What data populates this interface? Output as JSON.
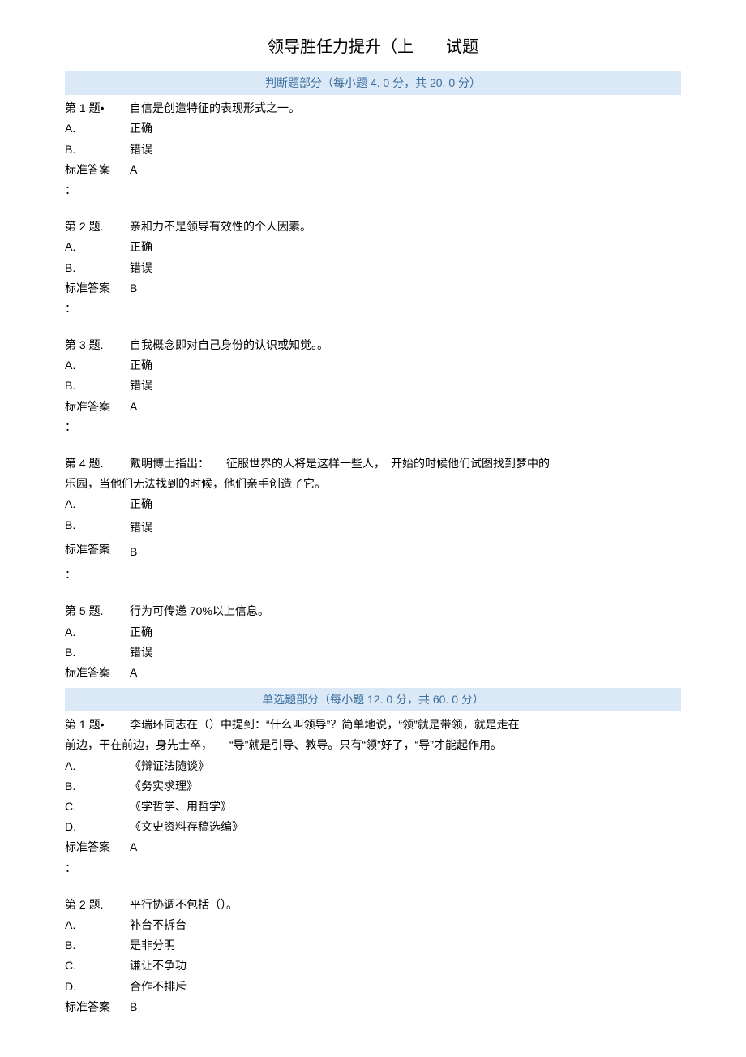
{
  "title": "领导胜任力提升（上　　试题",
  "section_judge_header": "判断题部分（每小题 4. 0 分，共 20. 0 分）",
  "section_single_header": "单选题部分（每小题 12. 0 分，共 60. 0 分）",
  "labels": {
    "answer": "标准答案",
    "colon": "：",
    "A": "A.",
    "B": "B.",
    "C": "C.",
    "D": "D."
  },
  "judge": [
    {
      "num": "第 1 题•",
      "stem": "自信是创造特征的表现形式之一。",
      "optA": "正确",
      "optB": "错误",
      "answer": "A"
    },
    {
      "num": "第 2 题.",
      "stem": "亲和力不是领导有效性的个人因素。",
      "optA": "正确",
      "optB": "错误",
      "answer": "B"
    },
    {
      "num": "第 3 题.",
      "stem": "自我概念即对自己身份的认识或知觉。。",
      "optA": "正确",
      "optB": "错误",
      "answer": "A"
    },
    {
      "num": "第 4 题.",
      "stem_line1": "戴明博士指出：　　征服世界的人将是这样一些人，　开始的时候他们试图找到梦中的",
      "stem_line2": "乐园，当他们无法找到的时候，他们亲手创造了它。",
      "optA": "正确",
      "optB": "错误",
      "answer": "B"
    },
    {
      "num": "第 5 题.",
      "stem": "行为可传递 70%以上信息。",
      "optA": "正确",
      "optB": "错误",
      "answer": "A"
    }
  ],
  "single": [
    {
      "num": "第 1 题•",
      "stem_line1": "李瑞环同志在（）中提到：“什么叫领导”？简单地说，“领”就是带领，就是走在",
      "stem_line2": "前边，干在前边，身先士卒，　　“导”就是引导、教导。只有“领”好了，“导”才能起作用。",
      "optA": "《辩证法随谈》",
      "optB": "《务实求理》",
      "optC": "《学哲学、用哲学》",
      "optD": "《文史资料存稿选编》",
      "answer": "A"
    },
    {
      "num": "第 2 题.",
      "stem": "平行协调不包括（）。",
      "optA": "补台不拆台",
      "optB": "是非分明",
      "optC": "谦让不争功",
      "optD": "合作不排斥",
      "answer": "B"
    }
  ]
}
